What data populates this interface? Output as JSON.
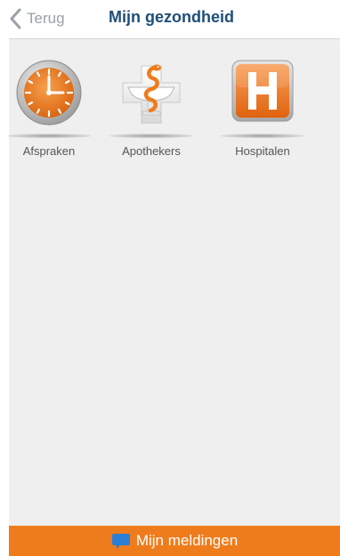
{
  "nav": {
    "back_label": "Terug",
    "title": "Mijn gezondheid"
  },
  "tiles": [
    {
      "label": "Afspraken",
      "icon": "clock-icon"
    },
    {
      "label": "Apothekers",
      "icon": "pharmacy-cross-icon"
    },
    {
      "label": "Hospitalen",
      "icon": "hospital-icon"
    }
  ],
  "footer": {
    "label": "Mijn meldingen",
    "icon": "chat-bubble-icon"
  },
  "colors": {
    "accent": "#ef7c1c",
    "title": "#1f4e79",
    "back": "#9aa0a6",
    "content_bg": "#efefef",
    "footer_icon": "#2a7fd4"
  }
}
